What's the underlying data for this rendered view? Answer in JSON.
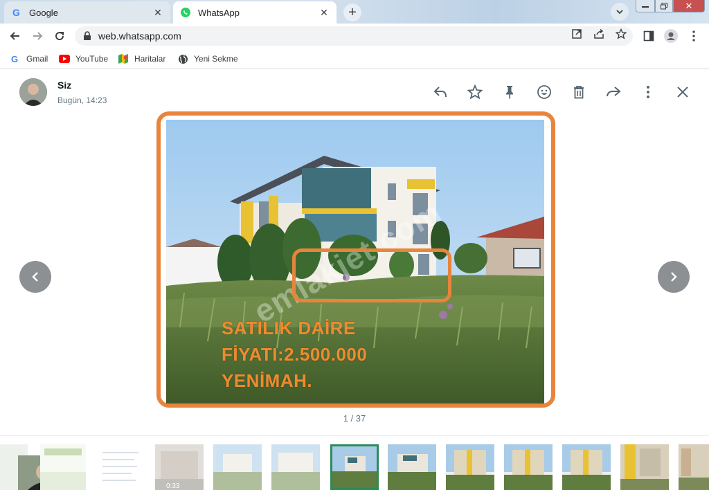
{
  "browser": {
    "tabs": [
      {
        "label": "Google",
        "icon": "google-icon"
      },
      {
        "label": "WhatsApp",
        "icon": "whatsapp-icon"
      }
    ],
    "url": "web.whatsapp.com",
    "window_controls": {
      "close_label": "✕"
    }
  },
  "bookmarks": [
    {
      "label": "Gmail",
      "icon": "google-icon"
    },
    {
      "label": "YouTube",
      "icon": "youtube-icon"
    },
    {
      "label": "Haritalar",
      "icon": "maps-icon"
    },
    {
      "label": "Yeni Sekme",
      "icon": "globe-icon"
    }
  ],
  "viewer": {
    "sender": "Siz",
    "time": "Bugün, 14:23",
    "actions": [
      "reply-icon",
      "star-icon",
      "pin-icon",
      "emoji-icon",
      "delete-icon",
      "forward-icon",
      "more-icon",
      "close-icon"
    ],
    "photo": {
      "watermark": "emlakjet.com",
      "lines": [
        "SATILIK DAİRE",
        "FİYATI:2.500.000",
        "YENİMAH."
      ]
    },
    "counter": "1 / 37",
    "thumbnails": {
      "video_duration": "0:33",
      "active_index": 6,
      "count": 13
    }
  },
  "colors": {
    "accent_orange": "#e8843c",
    "whatsapp_green": "#25d366",
    "active_thumb": "#2e8b57"
  }
}
